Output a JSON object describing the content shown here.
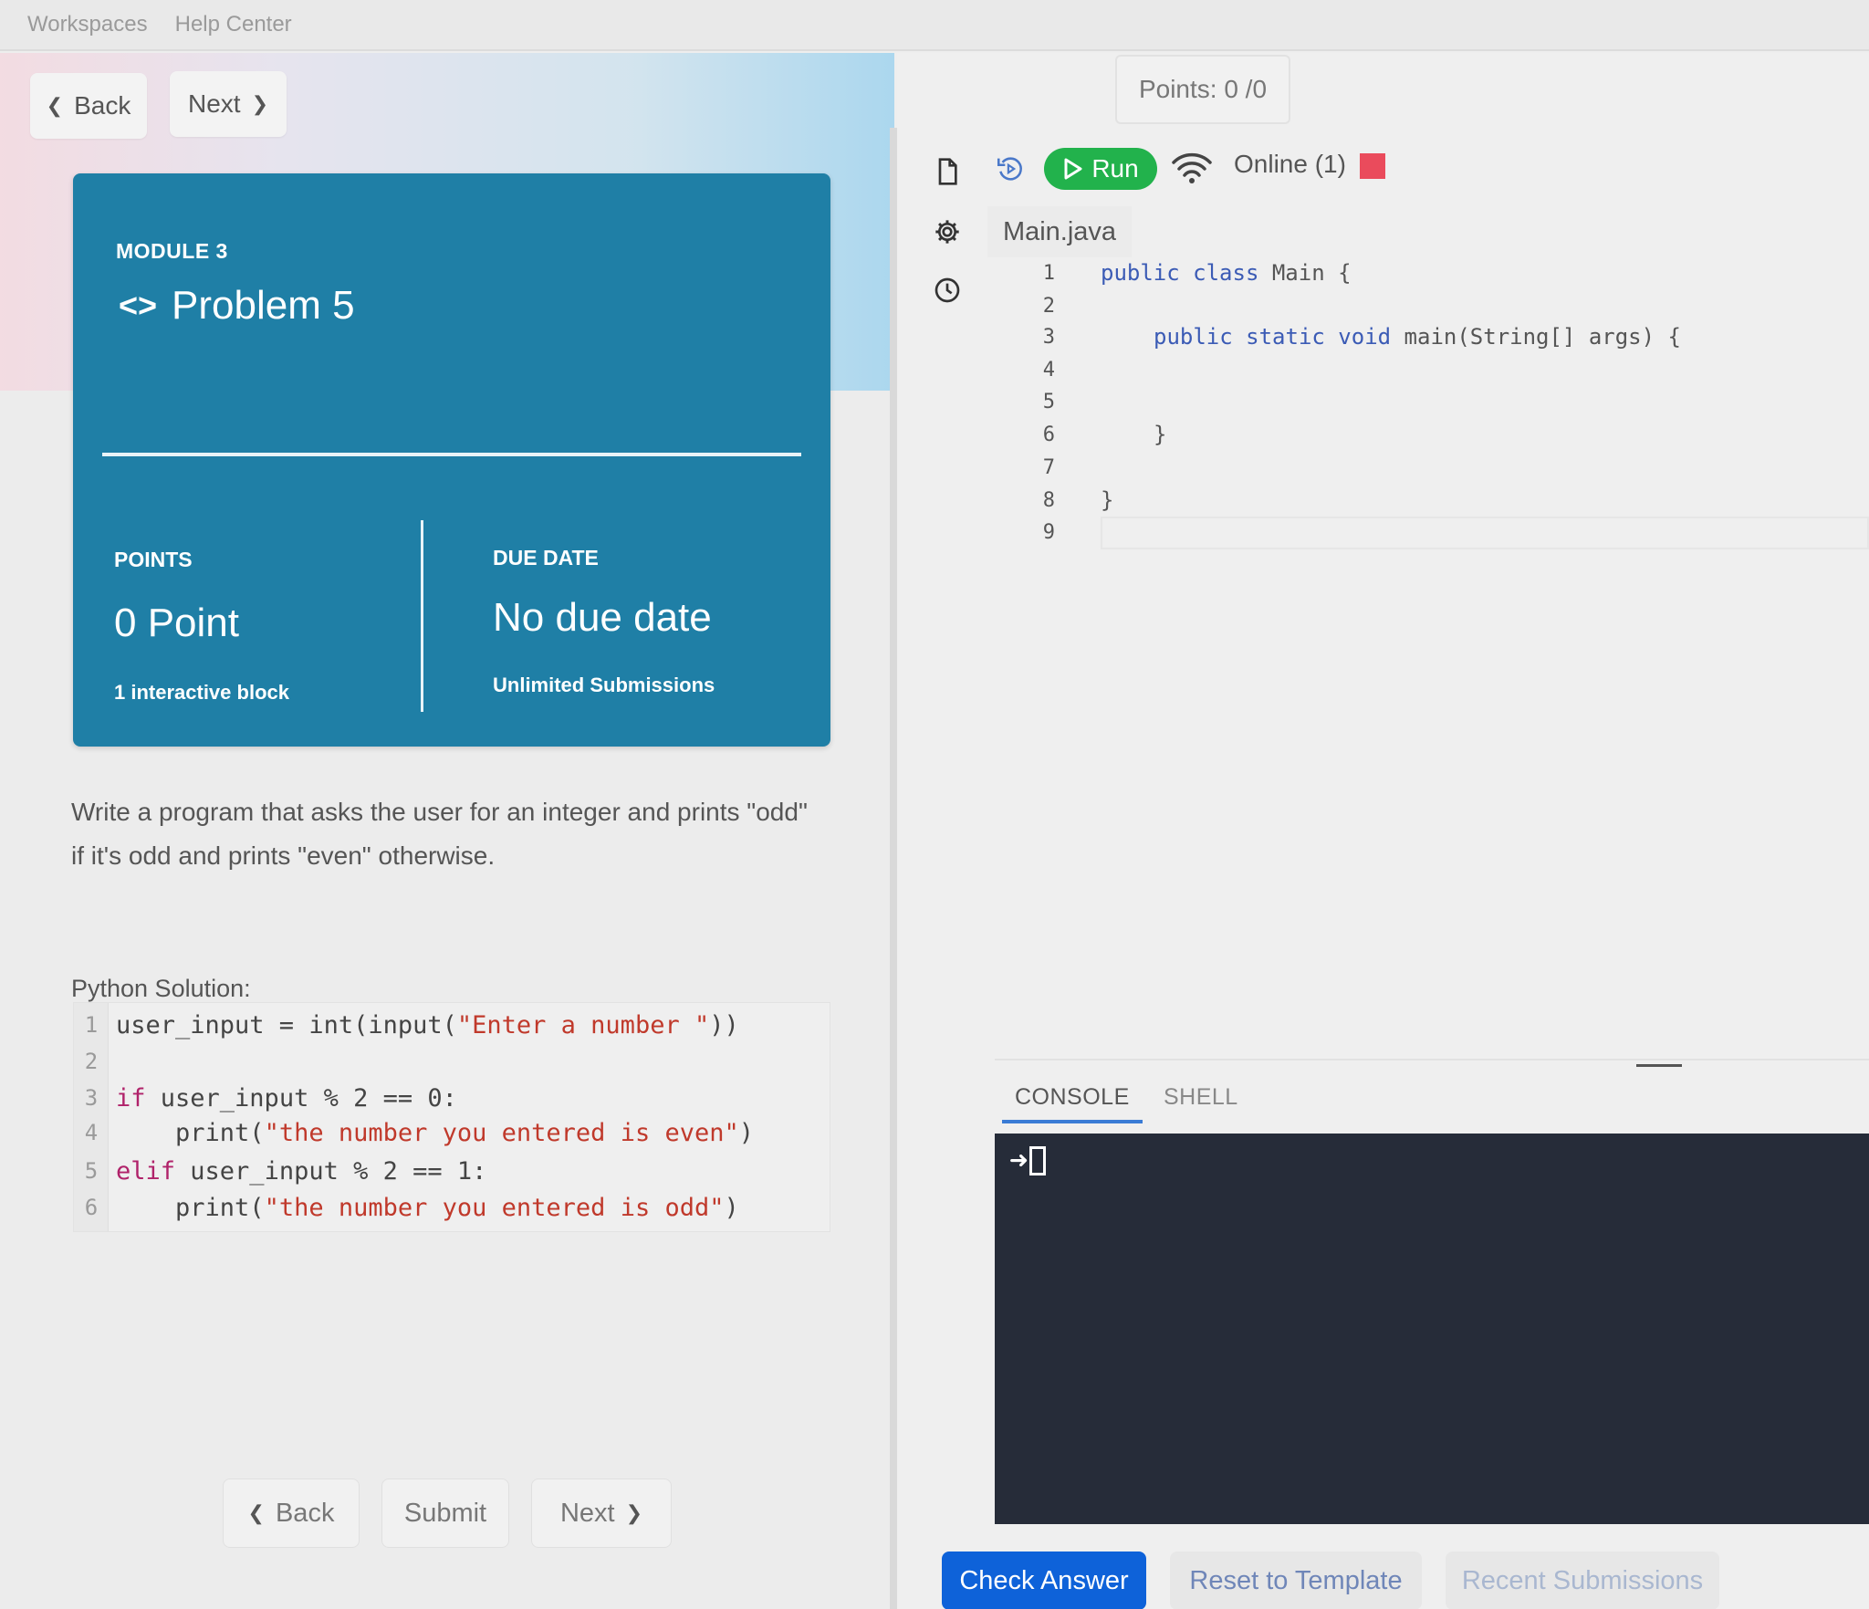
{
  "topnav": {
    "workspaces": "Workspaces",
    "help_center": "Help Center"
  },
  "nav": {
    "back": "Back",
    "next": "Next"
  },
  "card": {
    "module": "MODULE 3",
    "title": "Problem 5",
    "points_label": "POINTS",
    "points_value": "0 Point",
    "points_sub": "1 interactive block",
    "due_label": "DUE DATE",
    "due_value": "No due date",
    "due_sub": "Unlimited Submissions"
  },
  "description": {
    "line1": "Write a program that asks the user for an integer and prints \"odd\"",
    "line2": "if it's odd and prints \"even\" otherwise."
  },
  "python_solution": {
    "label": "Python Solution:",
    "line_numbers": [
      "1",
      "2",
      "3",
      "4",
      "5",
      "6"
    ],
    "lines": [
      {
        "parts": [
          "user_input = int(input(",
          "\"Enter a number \"",
          "))"
        ]
      },
      {
        "parts": []
      },
      {
        "parts": [
          "if",
          " user_input % 2 == 0:"
        ]
      },
      {
        "parts": [
          "    print(",
          "\"the number you entered is even\"",
          ")"
        ]
      },
      {
        "parts": [
          "elif",
          " user_input % 2 == 1:"
        ]
      },
      {
        "parts": [
          "    print(",
          "\"the number you entered is odd\"",
          ")"
        ]
      }
    ]
  },
  "bottom_nav": {
    "back": "Back",
    "submit": "Submit",
    "next": "Next"
  },
  "right": {
    "points": "Points: 0 /0",
    "run": "Run",
    "online": "Online (1)",
    "file_tab": "Main.java",
    "colors": {
      "run": "#22b24c",
      "stop": "#ea4b5c",
      "check": "#0e62d9",
      "console_bg": "#262c39"
    },
    "editor": {
      "line_numbers": [
        "1",
        "2",
        "3",
        "4",
        "5",
        "6",
        "7",
        "8",
        "9"
      ],
      "l1_kw": "public class",
      "l1_rest": " Main {",
      "l3_kw": "public static void",
      "l3_rest": " main(String[] args) {",
      "l6": "}",
      "l8": "}"
    },
    "console_tabs": {
      "console": "CONSOLE",
      "shell": "SHELL"
    },
    "prompt_symbol": "➜",
    "actions": {
      "check": "Check Answer",
      "reset": "Reset to Template",
      "recent": "Recent Submissions"
    }
  },
  "icons": [
    "chevron-left-icon",
    "chevron-right-icon",
    "code-icon",
    "file-icon",
    "gear-icon",
    "history-icon",
    "reset-icon",
    "play-icon",
    "wifi-icon",
    "stop-icon"
  ]
}
